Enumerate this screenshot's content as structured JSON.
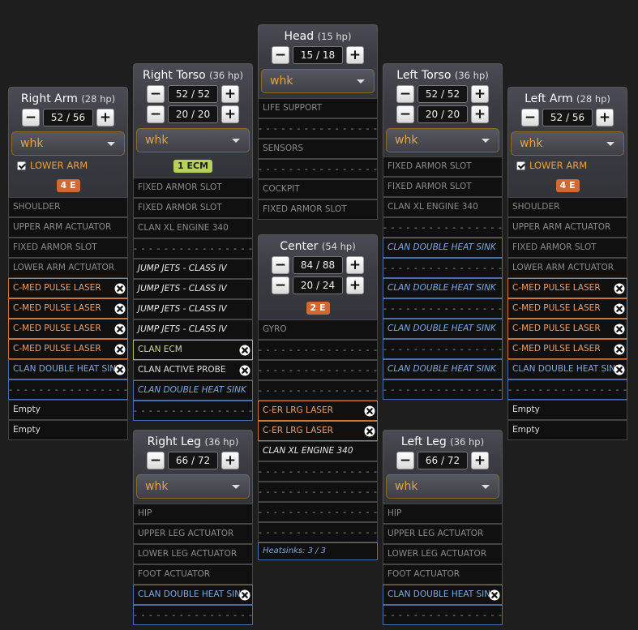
{
  "x_icon": "close-icon",
  "colors": {
    "accent": "#e8a33a",
    "weapon": "#c87838",
    "heatsink": "#4a6ea8",
    "ecm": "#a8c060",
    "badge_orange": "#d06a32",
    "badge_green": "#b5d25a"
  },
  "right_arm": {
    "name": "Right Arm",
    "hp": "(28 hp)",
    "armor": "52 / 56",
    "select": "whk",
    "lower_arm_label": "LOWER ARM",
    "badge": "4 E",
    "slots": [
      "SHOULDER",
      "UPPER ARM ACTUATOR",
      "FIXED ARMOR SLOT",
      "LOWER ARM ACTUATOR",
      "C-MED PULSE LASER",
      "C-MED PULSE LASER",
      "C-MED PULSE LASER",
      "C-MED PULSE LASER",
      "CLAN DOUBLE HEAT SINK",
      "- - - - - - - - - - - - - - - - -",
      "Empty",
      "Empty"
    ]
  },
  "right_torso": {
    "name": "Right Torso",
    "hp": "(36 hp)",
    "armor_front": "52 / 52",
    "armor_rear": "20 / 20",
    "select": "whk",
    "badge": "1 ECM",
    "slots": [
      "FIXED ARMOR SLOT",
      "FIXED ARMOR SLOT",
      "CLAN XL ENGINE 340",
      "- - - - - - - - - - - - - - - - -",
      "JUMP JETS - CLASS IV",
      "JUMP JETS - CLASS IV",
      "JUMP JETS - CLASS IV",
      "JUMP JETS - CLASS IV",
      "CLAN ECM",
      "CLAN ACTIVE PROBE",
      "CLAN DOUBLE HEAT SINK",
      "- - - - - - - - - - - - - - - - -"
    ]
  },
  "head": {
    "name": "Head",
    "hp": "(15 hp)",
    "armor": "15 / 18",
    "select": "whk",
    "slots": [
      "LIFE SUPPORT",
      "- - - - - - - - - - - - - - - - -",
      "SENSORS",
      "- - - - - - - - - - - - - - - - -",
      "COCKPIT",
      "FIXED ARMOR SLOT"
    ]
  },
  "center": {
    "name": "Center",
    "hp": "(54 hp)",
    "armor_front": "84 / 88",
    "armor_rear": "20 / 24",
    "badge": "2 E",
    "slots": [
      "GYRO",
      "- - - - - - - - - - - - - - - - -",
      "- - - - - - - - - - - - - - - - -",
      "- - - - - - - - - - - - - - - - -",
      "C-ER LRG LASER",
      "C-ER LRG LASER",
      "CLAN XL ENGINE 340",
      "- - - - - - - - - - - - - - - - -",
      "- - - - - - - - - - - - - - - - -",
      "- - - - - - - - - - - - - - - - -",
      "- - - - - - - - - - - - - - - - -"
    ],
    "heatsinks": "Heatsinks: 3 / 3"
  },
  "left_torso": {
    "name": "Left Torso",
    "hp": "(36 hp)",
    "armor_front": "52 / 52",
    "armor_rear": "20 / 20",
    "select": "whk",
    "slots": [
      "FIXED ARMOR SLOT",
      "FIXED ARMOR SLOT",
      "CLAN XL ENGINE 340",
      "- - - - - - - - - - - - - - - - -",
      "CLAN DOUBLE HEAT SINK",
      "- - - - - - - - - - - - - - - - -",
      "CLAN DOUBLE HEAT SINK",
      "- - - - - - - - - - - - - - - - -",
      "CLAN DOUBLE HEAT SINK",
      "- - - - - - - - - - - - - - - - -",
      "CLAN DOUBLE HEAT SINK",
      "- - - - - - - - - - - - - - - - -"
    ]
  },
  "left_arm": {
    "name": "Left Arm",
    "hp": "(28 hp)",
    "armor": "52 / 56",
    "select": "whk",
    "lower_arm_label": "LOWER ARM",
    "badge": "4 E",
    "slots": [
      "SHOULDER",
      "UPPER ARM ACTUATOR",
      "FIXED ARMOR SLOT",
      "LOWER ARM ACTUATOR",
      "C-MED PULSE LASER",
      "C-MED PULSE LASER",
      "C-MED PULSE LASER",
      "C-MED PULSE LASER",
      "CLAN DOUBLE HEAT SINK",
      "- - - - - - - - - - - - - - - - -",
      "Empty",
      "Empty"
    ]
  },
  "right_leg": {
    "name": "Right Leg",
    "hp": "(36 hp)",
    "armor": "66 / 72",
    "select": "whk",
    "slots": [
      "HIP",
      "UPPER LEG ACTUATOR",
      "LOWER LEG ACTUATOR",
      "FOOT ACTUATOR",
      "CLAN DOUBLE HEAT SINK",
      "- - - - - - - - - - - - - - - - -"
    ]
  },
  "left_leg": {
    "name": "Left Leg",
    "hp": "(36 hp)",
    "armor": "66 / 72",
    "select": "whk",
    "slots": [
      "HIP",
      "UPPER LEG ACTUATOR",
      "LOWER LEG ACTUATOR",
      "FOOT ACTUATOR",
      "CLAN DOUBLE HEAT SINK",
      "- - - - - - - - - - - - - - - - -"
    ]
  }
}
